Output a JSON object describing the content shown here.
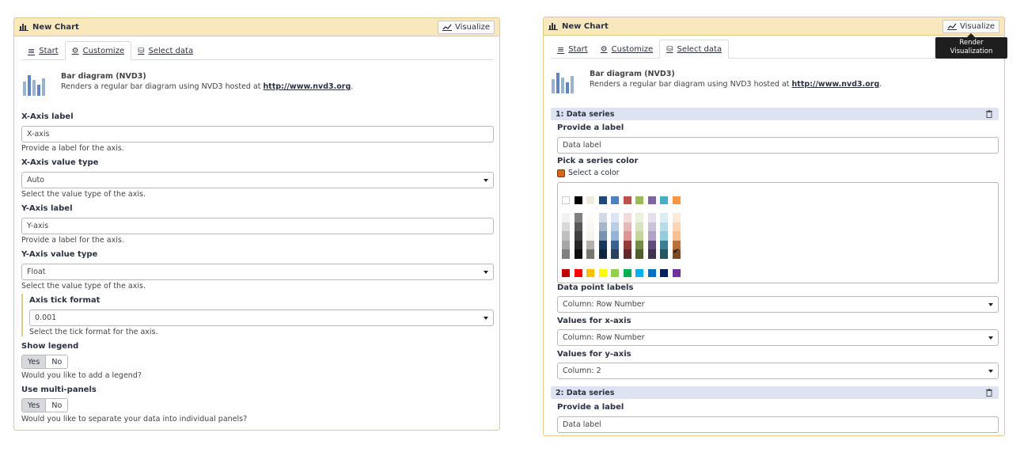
{
  "left": {
    "header_title": "New Chart",
    "visualize_label": "Visualize",
    "tabs": [
      "Start",
      "Customize",
      "Select data"
    ],
    "active_tab": "Customize",
    "chart_name": "Bar diagram (NVD3)",
    "chart_desc_prefix": "Renders a regular bar diagram using NVD3 hosted at ",
    "chart_desc_link": "http://www.nvd3.org",
    "chart_desc_suffix": ".",
    "fields": {
      "x_label": {
        "label": "X-Axis label",
        "value": "X-axis",
        "help": "Provide a label for the axis."
      },
      "x_type": {
        "label": "X-Axis value type",
        "value": "Auto",
        "help": "Select the value type of the axis."
      },
      "y_label": {
        "label": "Y-Axis label",
        "value": "Y-axis",
        "help": "Provide a label for the axis."
      },
      "y_type": {
        "label": "Y-Axis value type",
        "value": "Float",
        "help": "Select the value type of the axis."
      },
      "tick": {
        "label": "Axis tick format",
        "value": "0.001",
        "help": "Select the tick format for the axis."
      },
      "legend": {
        "label": "Show legend",
        "yes": "Yes",
        "no": "No",
        "selected": "Yes",
        "help": "Would you like to add a legend?"
      },
      "multi": {
        "label": "Use multi-panels",
        "yes": "Yes",
        "no": "No",
        "selected": "Yes",
        "help": "Would you like to separate your data into individual panels?"
      }
    }
  },
  "right": {
    "header_title": "New Chart",
    "visualize_label": "Visualize",
    "tooltip": "Render Visualization",
    "tabs": [
      "Start",
      "Customize",
      "Select data"
    ],
    "active_tab": "Select data",
    "chart_name": "Bar diagram (NVD3)",
    "chart_desc_prefix": "Renders a regular bar diagram using NVD3 hosted at ",
    "chart_desc_link": "http://www.nvd3.org",
    "chart_desc_suffix": ".",
    "series1": {
      "title": "1: Data series",
      "label_title": "Provide a label",
      "label_value": "Data label",
      "color_title": "Pick a series color",
      "color_select": "Select a color",
      "selected_color": "#d2691e",
      "point_labels_title": "Data point labels",
      "point_labels_value": "Column: Row Number",
      "x_title": "Values for x-axis",
      "x_value": "Column: Row Number",
      "y_title": "Values for y-axis",
      "y_value": "Column: 2"
    },
    "series2": {
      "title": "2: Data series",
      "label_title": "Provide a label",
      "label_value": "Data label"
    }
  },
  "colors": {
    "panel_border": "#e3c98a",
    "header_bg": "#f9e7bd",
    "series_bg": "#dde3f1",
    "palette_top": [
      "#ffffff",
      "#000000",
      "#eeece1",
      "#1f497d",
      "#4f81bd",
      "#c0504d",
      "#9bbb59",
      "#8064a2",
      "#4bacc6",
      "#f79646"
    ],
    "palette_bottom": [
      "#c00000",
      "#ff0000",
      "#ffc000",
      "#ffff00",
      "#92d050",
      "#00b050",
      "#00b0f0",
      "#0070c0",
      "#002060",
      "#7030a0"
    ]
  }
}
